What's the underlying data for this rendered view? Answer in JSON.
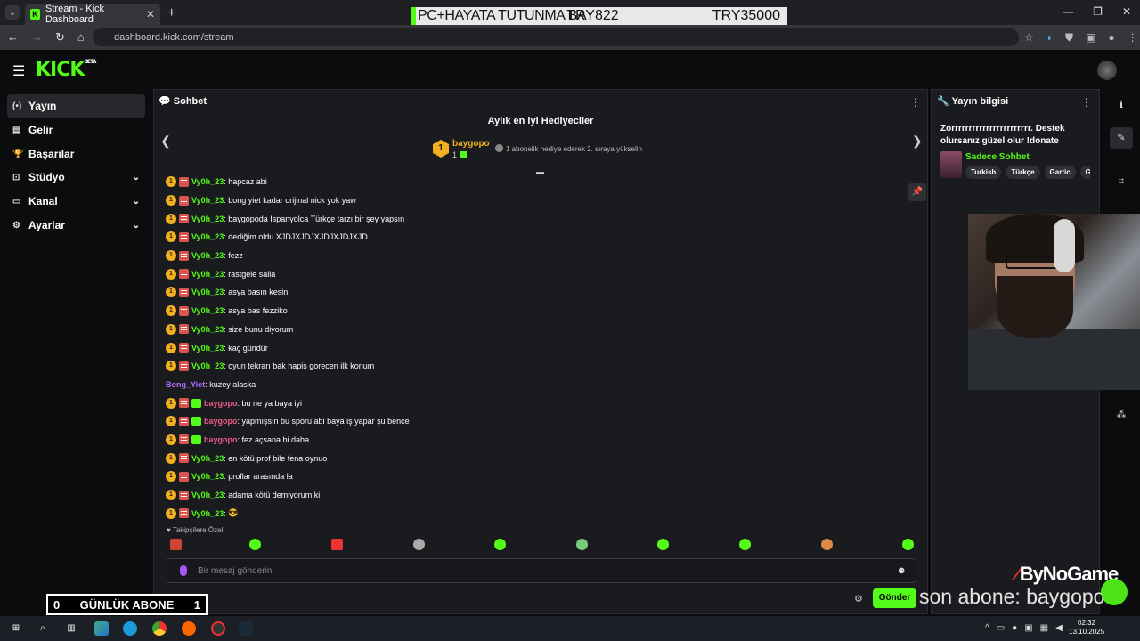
{
  "browser": {
    "tab_title": "Stream - Kick Dashboard",
    "url": "dashboard.kick.com/stream",
    "tab_icon": "kick-favicon"
  },
  "overlay": {
    "goal_text": "PC+HAYATA TUTUNMA BARIŞ822",
    "goal_title": "PC+HAYATA TUTUNMA BA",
    "goal_current": "TRY822",
    "goal_target": "TRY35000",
    "daily_sub_left": "0",
    "daily_sub_label": "GÜNLÜK ABONE",
    "daily_sub_right": "1",
    "brand": "ByNoGame",
    "last_sub": "son abone: baygopo",
    "accent": "#53fc18"
  },
  "header": {
    "logo": "KICK",
    "logo_badge": "BETA"
  },
  "sidebar": {
    "items": [
      {
        "label": "Yayın",
        "icon": "broadcast-icon"
      },
      {
        "label": "Gelir",
        "icon": "wallet-icon"
      },
      {
        "label": "Başarılar",
        "icon": "trophy-icon"
      },
      {
        "label": "Stüdyo",
        "icon": "studio-icon"
      },
      {
        "label": "Kanal",
        "icon": "channel-icon"
      },
      {
        "label": "Ayarlar",
        "icon": "gear-icon"
      }
    ]
  },
  "chat": {
    "header": "Sohbet",
    "gifters_title": "Aylık en iyi Hediyeciler",
    "top_rank": "1",
    "top_gifter": "baygopo",
    "top_count": "1",
    "top_note": "1 abonelik hediye ederek 2. sıraya yükselin",
    "messages": [
      {
        "user": "Vy0h_23",
        "text": "hapcaz abi",
        "color": "gr",
        "badges": 2
      },
      {
        "user": "Vy0h_23",
        "text": "bong yiet kadar orijinal nick yok yaw",
        "color": "gr",
        "badges": 2
      },
      {
        "user": "Vy0h_23",
        "text": "baygopoda İspanyolca Türkçe tarzı bir şey yapsın",
        "color": "gr",
        "badges": 2
      },
      {
        "user": "Vy0h_23",
        "text": "dediğim oldu XJDJXJDJXJDJXJDJXJD",
        "color": "gr",
        "badges": 2
      },
      {
        "user": "Vy0h_23",
        "text": "fezz",
        "color": "gr",
        "badges": 2
      },
      {
        "user": "Vy0h_23",
        "text": "rastgele salla",
        "color": "gr",
        "badges": 2
      },
      {
        "user": "Vy0h_23",
        "text": "asya basın kesin",
        "color": "gr",
        "badges": 2
      },
      {
        "user": "Vy0h_23",
        "text": "asya bas fezziko",
        "color": "gr",
        "badges": 2
      },
      {
        "user": "Vy0h_23",
        "text": "size bunu diyorum",
        "color": "gr",
        "badges": 2
      },
      {
        "user": "Vy0h_23",
        "text": "kaç gündür",
        "color": "gr",
        "badges": 2
      },
      {
        "user": "Vy0h_23",
        "text": "oyun tekrarı bak hapis gorecen ilk konum",
        "color": "gr",
        "badges": 2
      },
      {
        "user": "Bong_Yiet",
        "text": "kuzey alaska",
        "color": "pu",
        "badges": 0
      },
      {
        "user": "baygopo",
        "text": "bu ne ya baya iyi",
        "color": "pk",
        "badges": 3
      },
      {
        "user": "baygopo",
        "text": "yapmışsın bu sporu abi baya iş yapar şu bence",
        "color": "pk",
        "badges": 3
      },
      {
        "user": "baygopo",
        "text": "fez açsana bi daha",
        "color": "pk",
        "badges": 3
      },
      {
        "user": "Vy0h_23",
        "text": "en kötü prof bile fena oynuo",
        "color": "gr",
        "badges": 2
      },
      {
        "user": "Vy0h_23",
        "text": "proflar arasında la",
        "color": "gr",
        "badges": 2
      },
      {
        "user": "Vy0h_23",
        "text": "adama kötü demiyorum ki",
        "color": "gr",
        "badges": 2
      },
      {
        "user": "Vy0h_23",
        "text": "😎",
        "color": "gr",
        "badges": 2
      }
    ],
    "followers_only": "Takipçilere Özel",
    "input_placeholder": "Bir mesaj gönderin",
    "send_label": "Gönder"
  },
  "info": {
    "header": "Yayın bilgisi",
    "stream_title": "Zorrrrrrrrrrrrrrrrrrrrrrr. Destek olursanız güzel olur !donate",
    "category": "Sadece Sohbet",
    "tags": [
      "Turkish",
      "Türkçe",
      "Gartic",
      "Ge"
    ]
  },
  "taskbar": {
    "time": "02:32",
    "date": "13.10.2025"
  }
}
